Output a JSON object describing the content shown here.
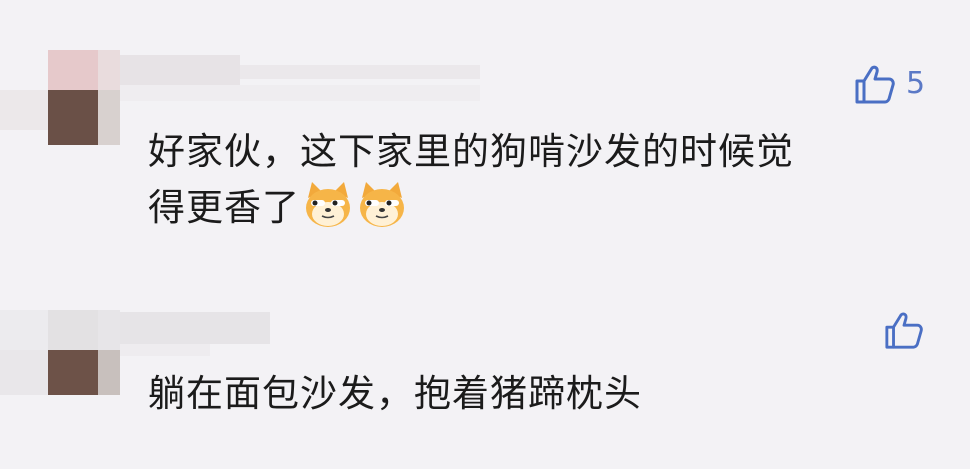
{
  "comments": [
    {
      "text_line1": "好家伙，这下家里的狗啃沙发的时候觉",
      "text_line2": "得更香了",
      "emojis": [
        "doge-emoji",
        "doge-emoji"
      ],
      "like_count": "5"
    },
    {
      "text_line1": "躺在面包沙发，抱着猪蹄枕头",
      "like_count": ""
    }
  ],
  "colors": {
    "background": "#f3f2f5",
    "like_icon": "#4a6fc4",
    "text": "#1b1b1b"
  }
}
